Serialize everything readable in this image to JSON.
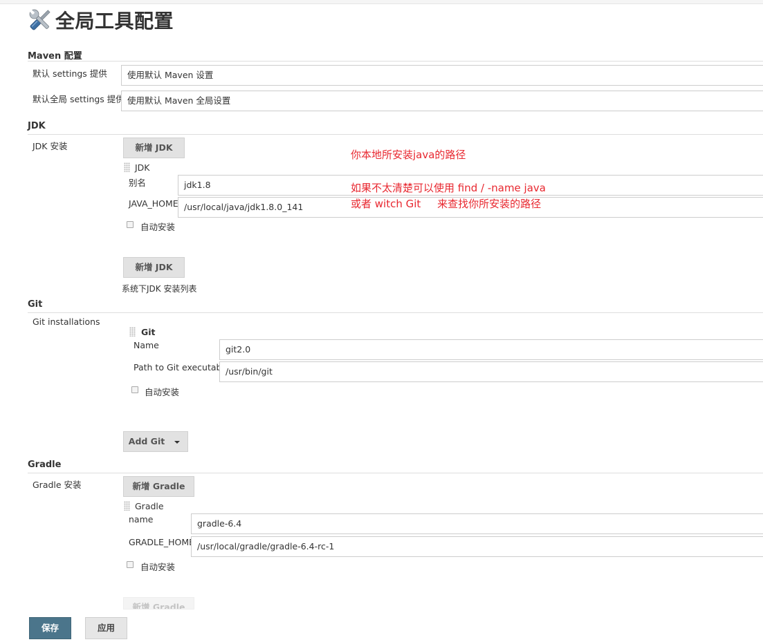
{
  "page": {
    "title": "全局工具配置",
    "icon": "wrench-screwdriver-icon"
  },
  "maven": {
    "header": "Maven 配置",
    "settings_label": "默认 settings 提供",
    "settings_value": "使用默认 Maven 设置",
    "global_settings_label": "默认全局 settings 提供",
    "global_settings_value": "使用默认 Maven 全局设置"
  },
  "jdk": {
    "header": "JDK",
    "install_label": "JDK 安装",
    "add_button": "新增 JDK",
    "item_title": "JDK",
    "alias_label": "别名",
    "alias_value": "jdk1.8",
    "home_label": "JAVA_HOME",
    "home_value": "/usr/local/java/jdk1.8.0_141",
    "auto_install": "自动安装",
    "add_button_bottom": "新增 JDK",
    "list_caption": "系统下JDK 安装列表"
  },
  "git": {
    "header": "Git",
    "install_label": "Git installations",
    "item_title": "Git",
    "name_label": "Name",
    "name_value": "git2.0",
    "path_label": "Path to Git executable",
    "path_value": "/usr/bin/git",
    "auto_install": "自动安装",
    "add_button": "Add Git"
  },
  "gradle": {
    "header": "Gradle",
    "install_label": "Gradle 安装",
    "add_button": "新增 Gradle",
    "item_title": "Gradle",
    "name_label": "name",
    "name_value": "gradle-6.4",
    "home_label": "GRADLE_HOME",
    "home_value": "/usr/local/gradle/gradle-6.4-rc-1",
    "auto_install": "自动安装",
    "add_button_bottom": "新增 Gradle"
  },
  "annotations": {
    "line1": "你本地所安装java的路径",
    "line2": "如果不太清楚可以使用 find / -name java",
    "line3": "或者 witch Git     来查找你所安装的路径",
    "color": "#e8272f"
  },
  "footer": {
    "save": "保存",
    "apply": "应用",
    "save_color": "#4b758b"
  }
}
